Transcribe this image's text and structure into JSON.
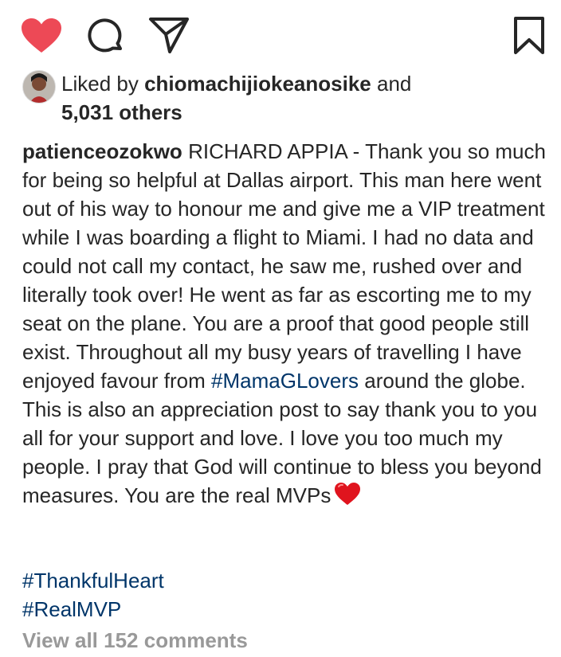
{
  "actions": {
    "like_icon": "heart-filled-icon",
    "comment_icon": "comment-bubble-icon",
    "share_icon": "send-paper-plane-icon",
    "save_icon": "bookmark-icon",
    "like_color": "#ed4956"
  },
  "likes": {
    "prefix": "Liked by",
    "user": "chiomachijiokeanosike",
    "conjunction": "and",
    "others": "5,031 others"
  },
  "post": {
    "username": "patienceozokwo",
    "body_part1": "RICHARD APPIA - Thank you so much for being so helpful at Dallas airport. This man here went out of his way to honour me and give me a VIP treatment while I was boarding a flight to Miami. I had no data and could not call my contact, he saw me, rushed over and literally took over! He went as far as escorting me to my seat on the plane. You are a proof that good people still exist. Throughout all my busy years of travelling I have enjoyed favour from",
    "hashtag_inline": "#MamaGLovers",
    "body_part2": "around the globe. This is also an appreciation post to say thank you to you all for your support and love. I love you too much my people. I pray that God will continue to bless you beyond measures. You are the real MVPs",
    "emoji": "red-heart-emoji",
    "tags": [
      "#ThankfulHeart",
      "#RealMVP"
    ]
  },
  "comments": {
    "view_all": "View all 152 comments"
  }
}
